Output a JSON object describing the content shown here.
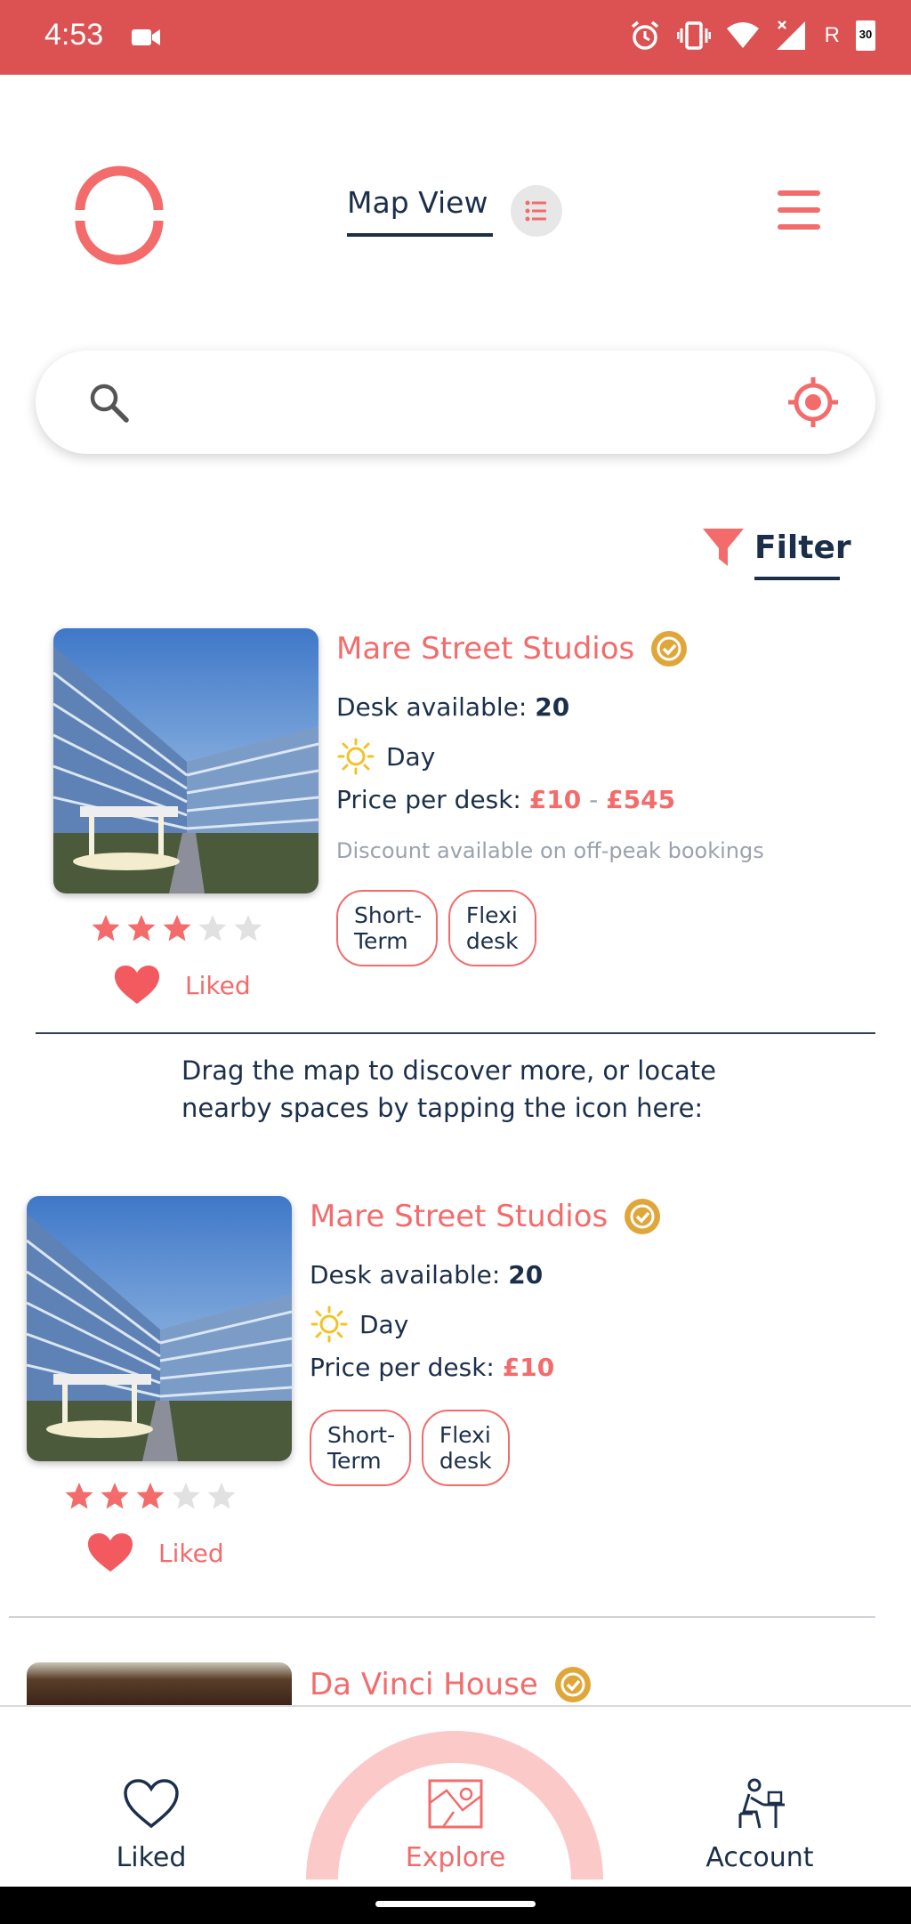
{
  "status_bar": {
    "time": "4:53",
    "battery": "30",
    "carrier_badge": "R"
  },
  "header": {
    "map_view_label": "Map View",
    "icons": [
      "logo-ring-icon",
      "list-icon",
      "hamburger-menu-icon"
    ]
  },
  "search": {
    "placeholder": "",
    "icons": [
      "search-icon",
      "locate-icon"
    ]
  },
  "filter": {
    "label": "Filter"
  },
  "listings": [
    {
      "title": "Mare Street Studios",
      "desk_label": "Desk available:",
      "desk_count": "20",
      "period": "Day",
      "price_label": "Price per desk:",
      "price_min": "£10",
      "price_sep": "-",
      "price_max": "£545",
      "note": "Discount available on off-peak bookings",
      "tags": [
        "Short-Term",
        "Flexi desk"
      ],
      "rating": 3,
      "rating_max": 5,
      "liked_label": "Liked"
    },
    {
      "title": "Mare Street Studios",
      "desk_label": "Desk available:",
      "desk_count": "20",
      "period": "Day",
      "price_label": "Price per desk:",
      "price_min": "£10",
      "tags": [
        "Short-Term",
        "Flexi desk"
      ],
      "rating": 3,
      "rating_max": 5,
      "liked_label": "Liked"
    },
    {
      "title": "Da Vinci House"
    }
  ],
  "hint": "Drag the map to discover more, or locate nearby spaces by tapping the icon here:",
  "bottom_nav": {
    "liked": "Liked",
    "explore": "Explore",
    "account": "Account"
  },
  "colors": {
    "accent": "#f36b6b",
    "status_bar": "#dc5151",
    "navy": "#1c2f4a",
    "verified": "#e0a63a"
  }
}
